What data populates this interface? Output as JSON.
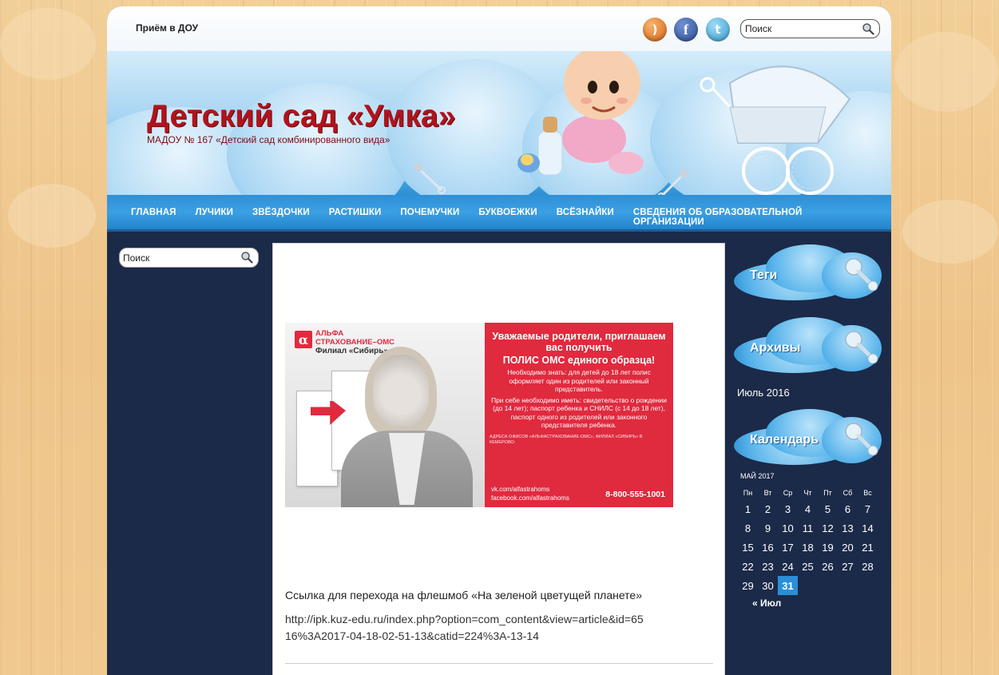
{
  "top": {
    "link": "Приём в ДОУ",
    "search_placeholder": "Поиск",
    "social": [
      "rss-icon",
      "facebook-icon",
      "twitter-icon"
    ]
  },
  "header": {
    "title": "Детский сад «Умка»",
    "subtitle": "МАДОУ № 167 «Детский сад комбинированного вида»"
  },
  "nav": {
    "items": [
      "Главная",
      "Лучики",
      "Звёздочки",
      "Растишки",
      "Почемучки",
      "Буквоежки",
      "Всёзнайки",
      "Сведения об образовательной организации"
    ]
  },
  "sidebar_left": {
    "search_placeholder": "Поиск"
  },
  "content": {
    "banner": {
      "brand_line1": "АЛЬФА",
      "brand_line2": "СТРАХОВАНИЕ–ОМС",
      "brand_line3": "Филиал «Сибирь»",
      "heading": "Уважаемые родители, приглашаем вас получить",
      "heading2": "ПОЛИС ОМС единого образца!",
      "body1": "Необходимо знать: для детей до 18 лет полис оформляет один из родителей или законный представитель.",
      "body2": "При себе необходимо иметь: свидетельство о рождении (до 14 лет); паспорт ребенка и СНИЛС (с 14 до 18 лет), паспорт одного из родителей или законного представителя ребенка.",
      "small": "АДРЕСА ОФИСОВ «АЛЬФАСТРАХОВАНИЕ-ОМС», ФИЛИАЛ «СИБИРЬ» В КЕМЕРОВО:",
      "vk": "vk.com/alfastrahoms",
      "fb": "facebook.com/alfastrahoms",
      "phone": "8-800-555-1001"
    },
    "link_caption": "Ссылка для перехода на флешмоб «На зеленой цветущей планете»",
    "url": "http://ipk.kuz-edu.ru/index.php?option=com_content&view=article&id=6516%3A2017-04-18-02-51-13&catid=224%3A-13-14"
  },
  "sidebar_right": {
    "tags_title": "Теги",
    "archives_title": "Архивы",
    "archive_link": "Июль 2016",
    "calendar_title": "Календарь",
    "calendar": {
      "caption": "МАЙ 2017",
      "weekdays": [
        "Пн",
        "Вт",
        "Ср",
        "Чт",
        "Пт",
        "Сб",
        "Вс"
      ],
      "weeks": [
        [
          "1",
          "2",
          "3",
          "4",
          "5",
          "6",
          "7"
        ],
        [
          "8",
          "9",
          "10",
          "11",
          "12",
          "13",
          "14"
        ],
        [
          "15",
          "16",
          "17",
          "18",
          "19",
          "20",
          "21"
        ],
        [
          "22",
          "23",
          "24",
          "25",
          "26",
          "27",
          "28"
        ],
        [
          "29",
          "30",
          "31",
          "",
          "",
          "",
          ""
        ]
      ],
      "today": "31",
      "prev_link": "« Июл"
    }
  },
  "colors": {
    "title_red": "#b1131c",
    "nav_blue": "#2f8fd6",
    "sidebar_dark": "#1b2a48",
    "banner_red": "#e02a3e"
  }
}
